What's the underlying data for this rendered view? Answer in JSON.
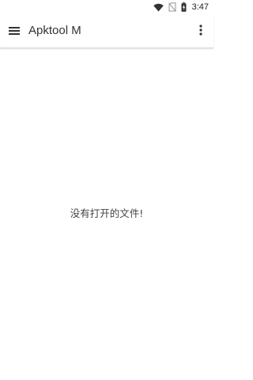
{
  "status_bar": {
    "time": "3:47",
    "icons": [
      "wifi-icon",
      "no-sim-icon",
      "battery-charging-icon"
    ]
  },
  "toolbar": {
    "title": "Apktool M",
    "menu_icon": "hamburger-menu-icon",
    "more_icon": "more-vert-icon"
  },
  "main": {
    "empty_message": "没有打开的文件!"
  },
  "colors": {
    "background": "#ffffff",
    "text_primary": "#333333",
    "icon": "#333333"
  }
}
